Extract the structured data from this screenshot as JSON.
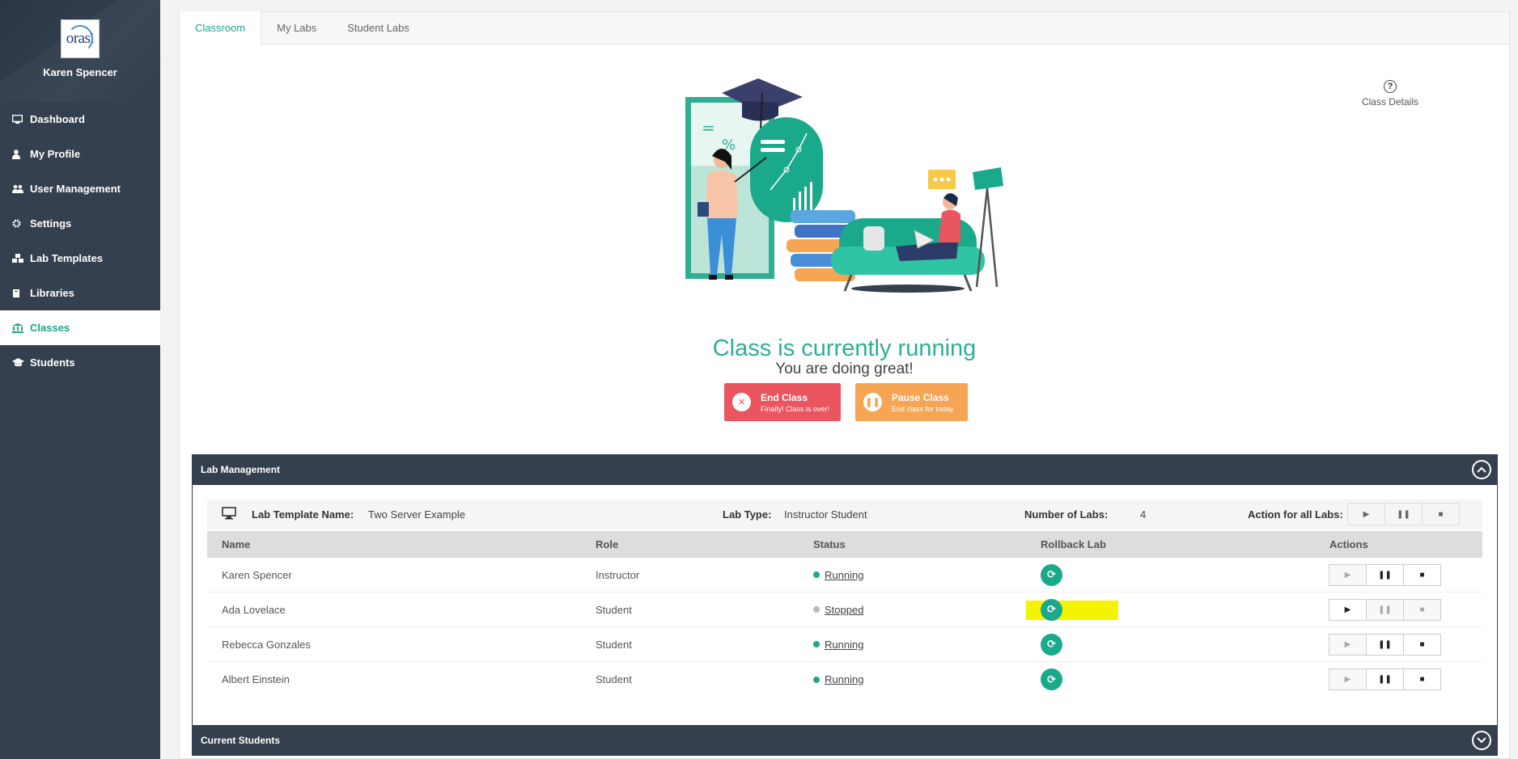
{
  "user": {
    "name": "Karen Spencer",
    "logo_text": "orasi"
  },
  "sidebar": {
    "items": [
      {
        "label": "Dashboard",
        "icon": "monitor-icon"
      },
      {
        "label": "My Profile",
        "icon": "user-icon"
      },
      {
        "label": "User Management",
        "icon": "users-icon"
      },
      {
        "label": "Settings",
        "icon": "gear-icon"
      },
      {
        "label": "Lab Templates",
        "icon": "cubes-icon"
      },
      {
        "label": "Libraries",
        "icon": "book-icon"
      },
      {
        "label": "Classes",
        "icon": "bank-icon",
        "active": true
      },
      {
        "label": "Students",
        "icon": "graduation-cap-icon"
      }
    ]
  },
  "tabs": [
    "Classroom",
    "My Labs",
    "Student Labs"
  ],
  "class_details_label": "Class Details",
  "hero": {
    "title": "Class is currently running",
    "subtitle": "You are doing great!"
  },
  "buttons": {
    "end": {
      "title": "End Class",
      "subtitle": "Finally! Class is over!"
    },
    "pause": {
      "title": "Pause Class",
      "subtitle": "End class for today"
    }
  },
  "lab_management": {
    "title": "Lab Management",
    "template_label": "Lab Template Name:",
    "template_value": "Two Server Example",
    "type_label": "Lab Type:",
    "type_value": "Instructor Student",
    "count_label": "Number of Labs:",
    "count_value": "4",
    "action_all_label": "Action for all Labs:",
    "columns": [
      "Name",
      "Role",
      "Status",
      "Rollback Lab",
      "Actions"
    ],
    "rows": [
      {
        "name": "Karen Spencer",
        "role": "Instructor",
        "status": "Running"
      },
      {
        "name": "Ada Lovelace",
        "role": "Student",
        "status": "Stopped"
      },
      {
        "name": "Rebecca Gonzales",
        "role": "Student",
        "status": "Running"
      },
      {
        "name": "Albert Einstein",
        "role": "Student",
        "status": "Running"
      }
    ]
  },
  "current_students": {
    "title": "Current Students"
  },
  "colors": {
    "accent": "#17a589",
    "sidebar": "#34404e",
    "end": "#ea5560",
    "pause": "#f5a553",
    "running": "#1aa98a",
    "stopped": "#bbbbbb",
    "highlight": "#f4f400"
  }
}
